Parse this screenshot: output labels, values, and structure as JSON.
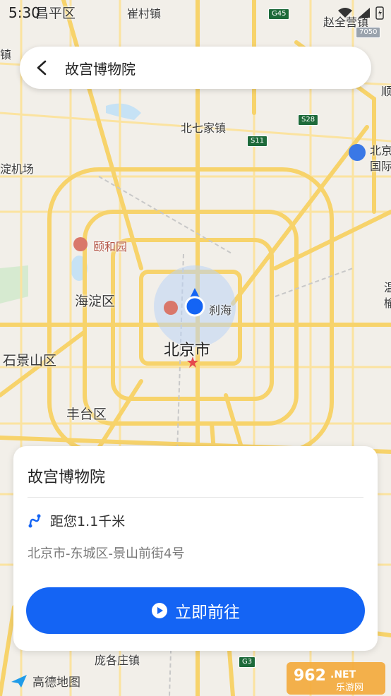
{
  "status_bar": {
    "time": "5:30"
  },
  "search": {
    "query": "故宫博物院"
  },
  "map_labels": {
    "changping": "昌平区",
    "cuicun": "崔村镇",
    "zhaoquanying": "赵全营镇",
    "beiqijia": "北七家镇",
    "beijing_airport": "北京",
    "airport_line2": "国际",
    "airfield": "淀机场",
    "summer_palace": "颐和园",
    "haidian": "海淀区",
    "shichahai": "刹海",
    "beijing_city": "北京市",
    "shijingshan": "石景山区",
    "fengtai": "丰台区",
    "panggezhuang": "庞各庄镇",
    "shun": "顺",
    "wen": "温",
    "ke": "榆",
    "left_zhen": "镇"
  },
  "road_shields": {
    "g45": "G45",
    "s28": "S28",
    "s11": "S11",
    "g3": "G3",
    "g505": "7050"
  },
  "poi_card": {
    "title": "故宫博物院",
    "distance": "距您1.1千米",
    "address": "北京市-东城区-景山前街4号",
    "go_button": "立即前往"
  },
  "map_brand": "高德地图",
  "watermark": {
    "number": "962",
    "tld": ".NET",
    "site": "乐游网"
  },
  "colors": {
    "accent": "#1464f4",
    "road_major": "#f7d36b",
    "road_minor": "#fbe3a0"
  }
}
